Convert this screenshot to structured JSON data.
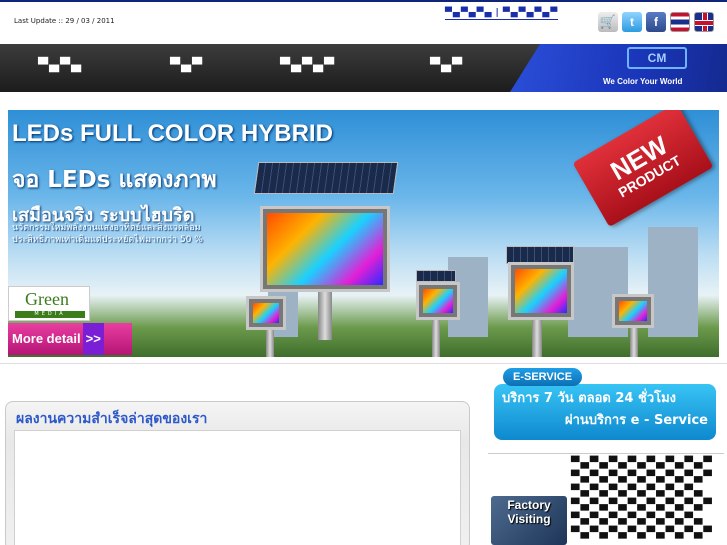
{
  "top": {
    "last_update": "Last Update :: 29 / 03 / 2011",
    "links": [
      "▀▄▀▄▀▄",
      "▀▄▀▄▀▄▀"
    ],
    "link_separator": "|"
  },
  "icons": [
    "cart-icon",
    "twitter-icon",
    "facebook-icon",
    "flag-thai-icon",
    "flag-uk-icon"
  ],
  "nav": {
    "items": [
      "▀▄▀▄",
      "▀▄▀",
      "▀▄▀▄▀",
      "▀▄▀"
    ],
    "brand_logo": "CM",
    "brand_tagline": "We Color Your World"
  },
  "banner": {
    "headline": "LEDs FULL COLOR HYBRID",
    "thai_line1": "จอ LEDs แสดงภาพ",
    "thai_line2": "เสมือนจริง ระบบไฮบริด",
    "thai_line3": "นวัตกรรมใหม่พลังงานแสงอาทิตย์และสิ่งแวดล้อม ประสิทธิภาพเท่าเดิมแต่ประหยัดไฟมากกว่า 50 %",
    "badge_line1": "NEW",
    "badge_line2": "PRODUCT",
    "logo_text": "Green",
    "logo_sub": "MEDIA",
    "more_detail": "More detail",
    "more_arrows": ">>"
  },
  "works": {
    "title": "ผลงานความสำเร็จล่าสุดของเรา"
  },
  "eservice": {
    "tag": "E-SERVICE",
    "line1": "บริการ 7 วัน ตลอด 24 ชั่วโมง",
    "line2": "ผ่านบริการ e - Service"
  },
  "sidebar": {
    "factory_label": "Factory Visiting",
    "links": [
      "▀▄▀▄▀▄▀▄▀▄▀▄▀▄▀",
      "▀▄▀▄▀▄▀▄▀▄▀▄▀▄▀",
      "▀▄▀▄▀▄▀▄▀▄▀▄▀▄",
      "▀▄▀▄▀▄▀▄▀▄▀▄▀▄▀",
      "▀▄▀▄▀▄▀▄▀▄▀▄▀▄",
      "▀▄▀▄▀▄▀▄▀▄▀▄▀▄▀"
    ]
  },
  "colors": {
    "nav_bg": "#2a2a2a",
    "brand_blue": "#1a35b8",
    "accent_pink": "#e83ea0",
    "eservice_blue": "#1e9ee8",
    "title_blue": "#2d58c9"
  }
}
